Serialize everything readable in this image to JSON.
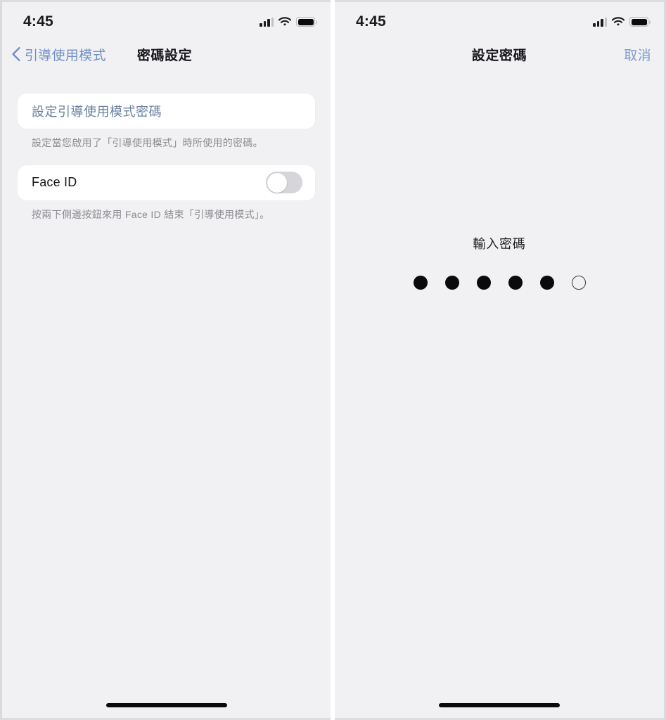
{
  "theme": {
    "screen_background": "#f1f1f4",
    "card_background": "#ffffff",
    "accent_blue": "#6f8ec4",
    "label_primary": "#16161a",
    "label_secondary": "#8b8b90",
    "dot_filled": "#0a0a0c",
    "toggle_track_off": "#d5d5da",
    "frame_border": "#d9d9de",
    "panel_gap": "#ffffff"
  },
  "left_screen": {
    "status_bar": {
      "time": "4:45",
      "cellular_icon": "signal-bars-icon",
      "cellular_bars_active": 3,
      "cellular_bars_total": 4,
      "wifi_icon": "wifi-icon",
      "battery_icon": "battery-full-icon",
      "battery_level_percent": 100
    },
    "nav_bar": {
      "back_icon": "chevron-left-icon",
      "back_label": "引導使用模式",
      "title": "密碼設定"
    },
    "groups": [
      {
        "rows": [
          {
            "type": "link",
            "label": "設定引導使用模式密碼",
            "name": "set-guided-access-passcode-row"
          }
        ],
        "footnote": "設定當您啟用了「引導使用模式」時所使用的密碼。"
      },
      {
        "rows": [
          {
            "type": "toggle",
            "label": "Face ID",
            "value": "off",
            "name": "face-id-row"
          }
        ],
        "footnote": "按兩下側邊按鈕來用 Face ID 結束「引導使用模式」。"
      }
    ],
    "home_indicator": "home-indicator"
  },
  "right_screen": {
    "status_bar": {
      "time": "4:45",
      "cellular_icon": "signal-bars-icon",
      "cellular_bars_active": 3,
      "cellular_bars_total": 4,
      "wifi_icon": "wifi-icon",
      "battery_icon": "battery-full-icon",
      "battery_level_percent": 100
    },
    "nav_bar": {
      "title": "設定密碼",
      "cancel_label": "取消"
    },
    "passcode": {
      "prompt": "輸入密碼",
      "length": 6,
      "entered_count": 5,
      "dots": [
        "filled",
        "filled",
        "filled",
        "filled",
        "filled",
        "empty"
      ]
    },
    "home_indicator": "home-indicator"
  }
}
